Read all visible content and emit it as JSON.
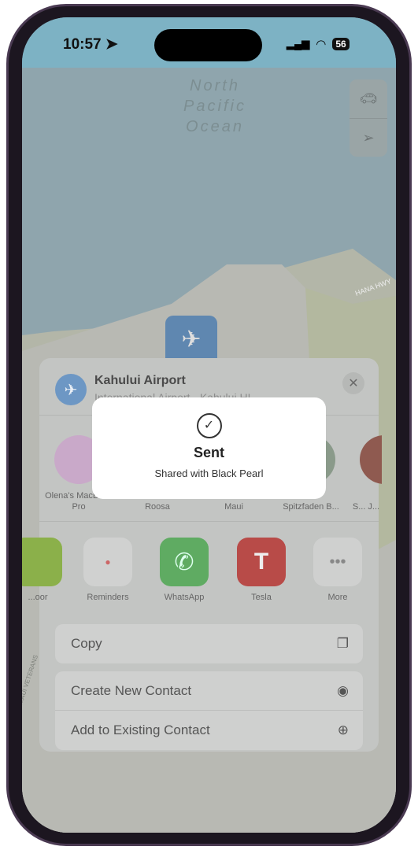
{
  "status": {
    "time": "10:57",
    "battery": "56"
  },
  "map": {
    "ocean_label_lines": [
      "North",
      "Pacific",
      "Ocean"
    ],
    "road_label": "HANA HWY",
    "road_label_2": "MAUI VETERANS"
  },
  "sheet": {
    "title": "Kahului Airport",
    "subtitle": "International Airport · Kahului HI",
    "people": [
      {
        "name": "Olena's MacBook Pro"
      },
      {
        "name": "Roosa"
      },
      {
        "name": "Maui"
      },
      {
        "name": "Spitzfaden B..."
      },
      {
        "name": "S... J..."
      }
    ],
    "apps": [
      {
        "name": "...oor"
      },
      {
        "name": "Reminders"
      },
      {
        "name": "WhatsApp"
      },
      {
        "name": "Tesla"
      },
      {
        "name": "More"
      }
    ],
    "actions": {
      "copy": "Copy",
      "create_contact": "Create New Contact",
      "add_existing": "Add to Existing Contact"
    }
  },
  "toast": {
    "title": "Sent",
    "message": "Shared with Black Pearl"
  }
}
